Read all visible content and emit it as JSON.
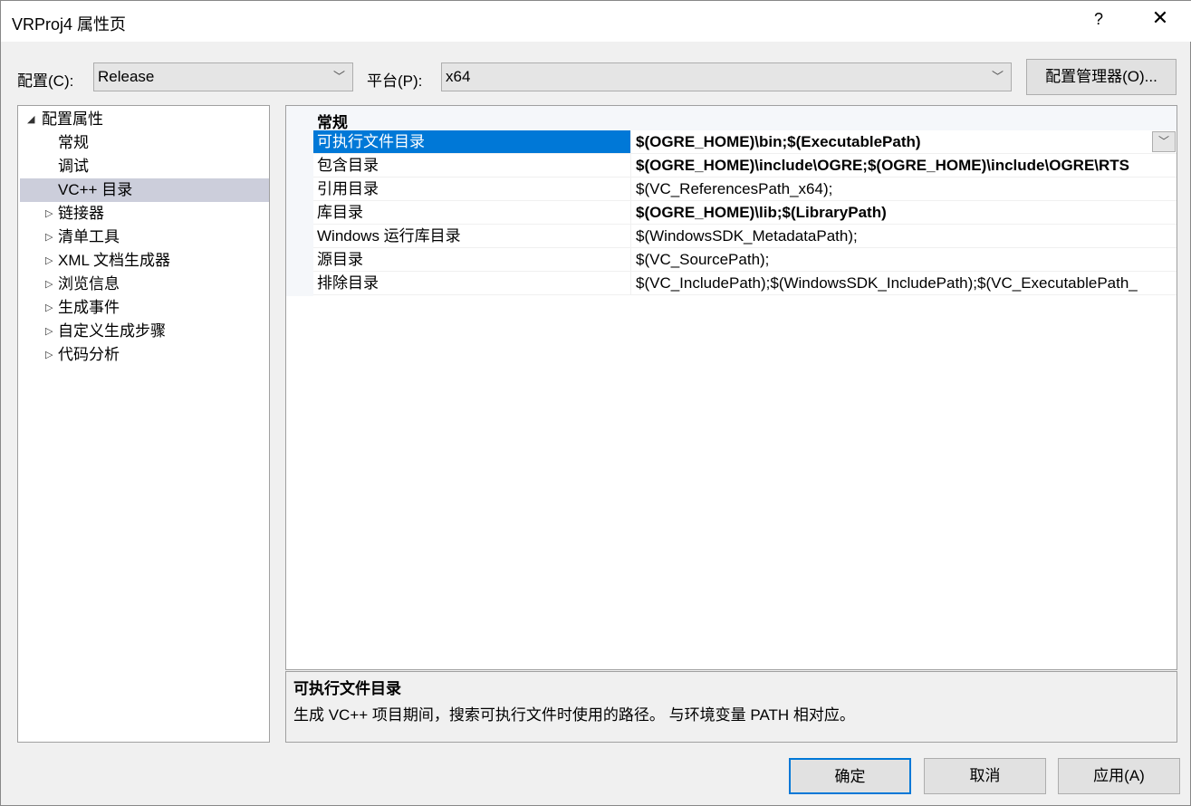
{
  "window": {
    "title": "VRProj4 属性页",
    "help": "?",
    "close": "✕"
  },
  "toolbar": {
    "config_label": "配置(C):",
    "config_value": "Release",
    "platform_label": "平台(P):",
    "platform_value": "x64",
    "config_manager": "配置管理器(O)..."
  },
  "tree": {
    "root": "配置属性",
    "items": [
      {
        "label": "常规",
        "expandable": false
      },
      {
        "label": "调试",
        "expandable": false
      },
      {
        "label": "VC++ 目录",
        "expandable": false,
        "selected": true
      },
      {
        "label": "链接器",
        "expandable": true
      },
      {
        "label": "清单工具",
        "expandable": true
      },
      {
        "label": "XML 文档生成器",
        "expandable": true
      },
      {
        "label": "浏览信息",
        "expandable": true
      },
      {
        "label": "生成事件",
        "expandable": true
      },
      {
        "label": "自定义生成步骤",
        "expandable": true
      },
      {
        "label": "代码分析",
        "expandable": true
      }
    ]
  },
  "grid": {
    "category": "常规",
    "rows": [
      {
        "name": "可执行文件目录",
        "value": "$(OGRE_HOME)\\bin;$(ExecutablePath)",
        "bold": true,
        "selected": true
      },
      {
        "name": "包含目录",
        "value": "$(OGRE_HOME)\\include\\OGRE;$(OGRE_HOME)\\include\\OGRE\\RTS",
        "bold": true
      },
      {
        "name": "引用目录",
        "value": "$(VC_ReferencesPath_x64);",
        "bold": false
      },
      {
        "name": "库目录",
        "value": "$(OGRE_HOME)\\lib;$(LibraryPath)",
        "bold": true
      },
      {
        "name": "Windows 运行库目录",
        "value": "$(WindowsSDK_MetadataPath);",
        "bold": false
      },
      {
        "name": "源目录",
        "value": "$(VC_SourcePath);",
        "bold": false
      },
      {
        "name": "排除目录",
        "value": "$(VC_IncludePath);$(WindowsSDK_IncludePath);$(VC_ExecutablePath_",
        "bold": false
      }
    ]
  },
  "description": {
    "title": "可执行文件目录",
    "text": "生成 VC++ 项目期间，搜索可执行文件时使用的路径。 与环境变量 PATH 相对应。"
  },
  "buttons": {
    "ok": "确定",
    "cancel": "取消",
    "apply": "应用(A)"
  },
  "colors": {
    "selection": "#0078d7",
    "tree_selection": "#cccedb"
  }
}
